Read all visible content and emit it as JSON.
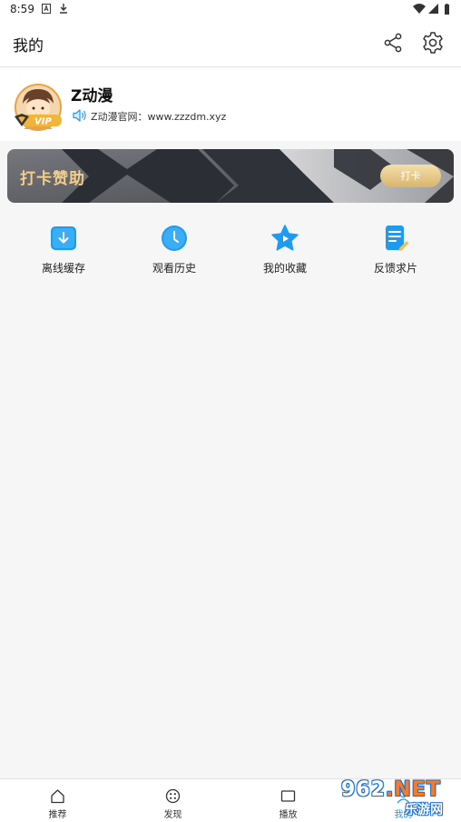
{
  "status_bar": {
    "time": "8:59"
  },
  "header": {
    "title": "我的"
  },
  "profile": {
    "username": "Z动漫",
    "website_label": "Z动漫官网：www.zzzdm.xyz",
    "badge": "VIP"
  },
  "banner": {
    "title": "打卡赞助",
    "button_label": "打卡"
  },
  "quick_actions": [
    {
      "label": "离线缓存",
      "icon": "download-icon",
      "color": "#1e9bf0"
    },
    {
      "label": "观看历史",
      "icon": "clock-icon",
      "color": "#1e9bf0"
    },
    {
      "label": "我的收藏",
      "icon": "star-icon",
      "color": "#1e9bf0"
    },
    {
      "label": "反馈求片",
      "icon": "feedback-icon",
      "color": "#1e9bf0"
    }
  ],
  "bottom_nav": [
    {
      "label": "推荐",
      "icon": "home-icon"
    },
    {
      "label": "发现",
      "icon": "discover-icon"
    },
    {
      "label": "播放",
      "icon": "play-icon"
    },
    {
      "label": "我的",
      "icon": "profile-icon"
    }
  ],
  "watermark": {
    "numbers": "962",
    "suffix": ".NET",
    "subtitle": "乐游网"
  }
}
